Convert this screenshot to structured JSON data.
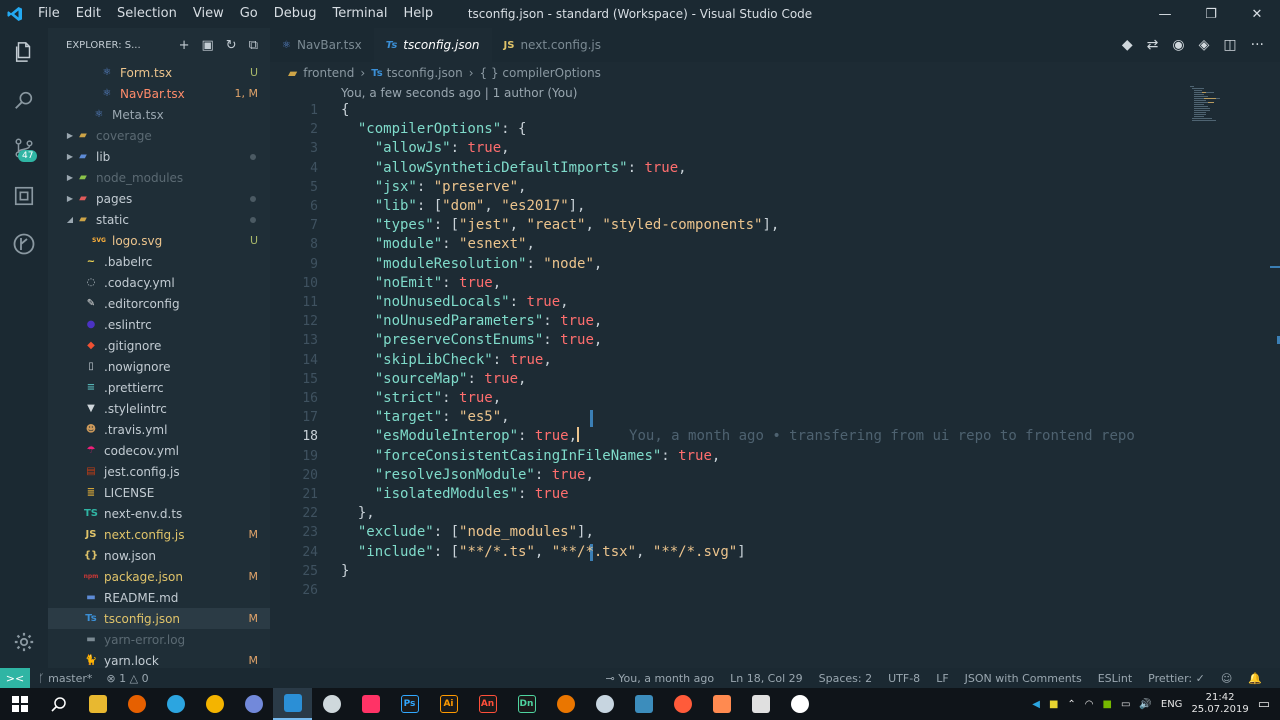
{
  "window": {
    "title": "tsconfig.json - standard (Workspace) - Visual Studio Code",
    "menu": [
      "File",
      "Edit",
      "Selection",
      "View",
      "Go",
      "Debug",
      "Terminal",
      "Help"
    ],
    "controls": [
      "—",
      "❐",
      "✕"
    ]
  },
  "activity": {
    "scm_badge": "47"
  },
  "sidebar": {
    "title": "EXPLORER: S...",
    "items": [
      {
        "name": "Form.tsx",
        "indent": 3,
        "icon": "react-icon",
        "color": "#ecc48d",
        "status": "U",
        "status_color": "#a8b86a",
        "kind": "file"
      },
      {
        "name": "NavBar.tsx",
        "indent": 3,
        "icon": "react-icon",
        "color": "#ff8b6a",
        "status": "1, M",
        "status_color": "#e0a36a",
        "kind": "file"
      },
      {
        "name": "Meta.tsx",
        "indent": 2,
        "icon": "react-icon",
        "color": "#9aa7b0",
        "status": "",
        "kind": "file"
      },
      {
        "name": "coverage",
        "indent": 0,
        "icon": "folder-icon",
        "color": "#5b6a73",
        "status": "",
        "kind": "folder",
        "folder_color": "#cda447"
      },
      {
        "name": "lib",
        "indent": 0,
        "icon": "folder-icon",
        "color": "#c3ccd3",
        "status": "dot",
        "kind": "folder",
        "folder_color": "#5d8bd6"
      },
      {
        "name": "node_modules",
        "indent": 0,
        "icon": "folder-icon",
        "color": "#5b6a73",
        "status": "",
        "kind": "folder",
        "folder_color": "#8bc34a"
      },
      {
        "name": "pages",
        "indent": 0,
        "icon": "folder-icon",
        "color": "#c3ccd3",
        "status": "dot",
        "kind": "folder",
        "folder_color": "#e05a5a"
      },
      {
        "name": "static",
        "indent": 0,
        "icon": "folder-icon",
        "color": "#c3ccd3",
        "status": "dot",
        "kind": "folder-open",
        "folder_color": "#cda447"
      },
      {
        "name": "logo.svg",
        "indent": 2,
        "icon": "svg-icon",
        "color": "#ecc48d",
        "status": "U",
        "status_color": "#a8b86a",
        "kind": "file"
      },
      {
        "name": ".babelrc",
        "indent": 1,
        "icon": "babel-icon",
        "color": "#c3ccd3",
        "status": "",
        "kind": "file"
      },
      {
        "name": ".codacy.yml",
        "indent": 1,
        "icon": "codacy-icon",
        "color": "#c3ccd3",
        "status": "",
        "kind": "file"
      },
      {
        "name": ".editorconfig",
        "indent": 1,
        "icon": "editorconfig-icon",
        "color": "#c3ccd3",
        "status": "",
        "kind": "file"
      },
      {
        "name": ".eslintrc",
        "indent": 1,
        "icon": "eslint-icon",
        "color": "#c3ccd3",
        "status": "",
        "kind": "file"
      },
      {
        "name": ".gitignore",
        "indent": 1,
        "icon": "git-icon",
        "color": "#c3ccd3",
        "status": "",
        "kind": "file"
      },
      {
        "name": ".nowignore",
        "indent": 1,
        "icon": "file-icon",
        "color": "#c3ccd3",
        "status": "",
        "kind": "file"
      },
      {
        "name": ".prettierrc",
        "indent": 1,
        "icon": "prettier-icon",
        "color": "#c3ccd3",
        "status": "",
        "kind": "file"
      },
      {
        "name": ".stylelintrc",
        "indent": 1,
        "icon": "stylelint-icon",
        "color": "#c3ccd3",
        "status": "",
        "kind": "file"
      },
      {
        "name": ".travis.yml",
        "indent": 1,
        "icon": "travis-icon",
        "color": "#c3ccd3",
        "status": "",
        "kind": "file"
      },
      {
        "name": "codecov.yml",
        "indent": 1,
        "icon": "codecov-icon",
        "color": "#c3ccd3",
        "status": "",
        "kind": "file"
      },
      {
        "name": "jest.config.js",
        "indent": 1,
        "icon": "jest-icon",
        "color": "#c3ccd3",
        "status": "",
        "kind": "file"
      },
      {
        "name": "LICENSE",
        "indent": 1,
        "icon": "license-icon",
        "color": "#c3ccd3",
        "status": "",
        "kind": "file"
      },
      {
        "name": "next-env.d.ts",
        "indent": 1,
        "icon": "ts-def-icon",
        "color": "#c3ccd3",
        "status": "",
        "kind": "file"
      },
      {
        "name": "next.config.js",
        "indent": 1,
        "icon": "js-icon",
        "color": "#e0c46a",
        "status": "M",
        "status_color": "#e0a36a",
        "kind": "file"
      },
      {
        "name": "now.json",
        "indent": 1,
        "icon": "json-icon",
        "color": "#c3ccd3",
        "status": "",
        "kind": "file"
      },
      {
        "name": "package.json",
        "indent": 1,
        "icon": "npm-icon",
        "color": "#e0c46a",
        "status": "M",
        "status_color": "#e0a36a",
        "kind": "file"
      },
      {
        "name": "README.md",
        "indent": 1,
        "icon": "markdown-icon",
        "color": "#c3ccd3",
        "status": "",
        "kind": "file"
      },
      {
        "name": "tsconfig.json",
        "indent": 1,
        "icon": "tsconfig-icon",
        "color": "#e0c46a",
        "status": "M",
        "status_color": "#e0a36a",
        "kind": "file",
        "active": true
      },
      {
        "name": "yarn-error.log",
        "indent": 1,
        "icon": "log-icon",
        "color": "#5b6a73",
        "status": "",
        "kind": "file"
      },
      {
        "name": "yarn.lock",
        "indent": 1,
        "icon": "yarn-icon",
        "color": "#c3ccd3",
        "status": "M",
        "status_color": "#e0a36a",
        "kind": "file"
      }
    ]
  },
  "tabs": [
    {
      "label": "NavBar.tsx",
      "icon_text": "⚛",
      "icon_color": "#5d8bd6",
      "active": false
    },
    {
      "label": "tsconfig.json",
      "icon_text": "Ts",
      "icon_color": "#3b8fd6",
      "active": true
    },
    {
      "label": "next.config.js",
      "icon_text": "JS",
      "icon_color": "#e0c46a",
      "active": false
    }
  ],
  "breadcrumb": [
    "frontend",
    "tsconfig.json",
    "{ } compilerOptions"
  ],
  "editor": {
    "codelens": "You, a few seconds ago | 1 author (You)",
    "blame": "You, a month ago • transfering from ui repo to frontend repo",
    "current_line": 18,
    "lines": [
      "{",
      "  \"compilerOptions\": {",
      "    \"allowJs\": true,",
      "    \"allowSyntheticDefaultImports\": true,",
      "    \"jsx\": \"preserve\",",
      "    \"lib\": [\"dom\", \"es2017\"],",
      "    \"types\": [\"jest\", \"react\", \"styled-components\"],",
      "    \"module\": \"esnext\",",
      "    \"moduleResolution\": \"node\",",
      "    \"noEmit\": true,",
      "    \"noUnusedLocals\": true,",
      "    \"noUnusedParameters\": true,",
      "    \"preserveConstEnums\": true,",
      "    \"skipLibCheck\": true,",
      "    \"sourceMap\": true,",
      "    \"strict\": true,",
      "    \"target\": \"es5\",",
      "    \"esModuleInterop\": true,",
      "    \"forceConsistentCasingInFileNames\": true,",
      "    \"resolveJsonModule\": true,",
      "    \"isolatedModules\": true",
      "  },",
      "  \"exclude\": [\"node_modules\"],",
      "  \"include\": [\"**/*.ts\", \"**/*.tsx\", \"**/*.svg\"]",
      "}",
      ""
    ]
  },
  "statusbar": {
    "branch": "master*",
    "errors": "1",
    "warnings": "0",
    "blame": "You, a month ago",
    "position": "Ln 18, Col 29",
    "spaces": "Spaces: 2",
    "encoding": "UTF-8",
    "eol": "LF",
    "language": "JSON with Comments",
    "eslint": "ESLint",
    "prettier": "Prettier: ✓"
  },
  "taskbar": {
    "apps": [
      {
        "name": "file-explorer-icon",
        "label": "",
        "color": "#e8b830"
      },
      {
        "name": "firefox-icon",
        "label": "",
        "color": "#e66000"
      },
      {
        "name": "telegram-icon",
        "label": "",
        "color": "#2ca5e0"
      },
      {
        "name": "chrome-icon",
        "label": "",
        "color": "#f4b400"
      },
      {
        "name": "discord-icon",
        "label": "",
        "color": "#7289da"
      },
      {
        "name": "vscode-icon",
        "label": "",
        "color": "#2b8fd6",
        "active": true
      },
      {
        "name": "obs-icon",
        "label": "",
        "color": "#cfd8dc"
      },
      {
        "name": "app-icon",
        "label": "",
        "color": "#ff3366"
      },
      {
        "name": "photoshop-icon",
        "label": "Ps",
        "color": "#31a8ff"
      },
      {
        "name": "illustrator-icon",
        "label": "Ai",
        "color": "#ff9a00"
      },
      {
        "name": "animate-icon",
        "label": "An",
        "color": "#ff4f3a"
      },
      {
        "name": "dimension-icon",
        "label": "Dn",
        "color": "#4ed4a0"
      },
      {
        "name": "blender-icon",
        "label": "",
        "color": "#ea7600"
      },
      {
        "name": "steam-icon",
        "label": "",
        "color": "#c7d5e0"
      },
      {
        "name": "bitwarden-icon",
        "label": "",
        "color": "#3c8dbc"
      },
      {
        "name": "firefox-dev-icon",
        "label": "",
        "color": "#ff5b3a"
      },
      {
        "name": "app-active-icon",
        "label": "",
        "color": "#ff8a50"
      },
      {
        "name": "photos-icon",
        "label": "",
        "color": "#e0e0e0"
      },
      {
        "name": "github-icon",
        "label": "",
        "color": "#ffffff"
      }
    ],
    "lang": "ENG",
    "time": "21:42",
    "date": "25.07.2019"
  }
}
